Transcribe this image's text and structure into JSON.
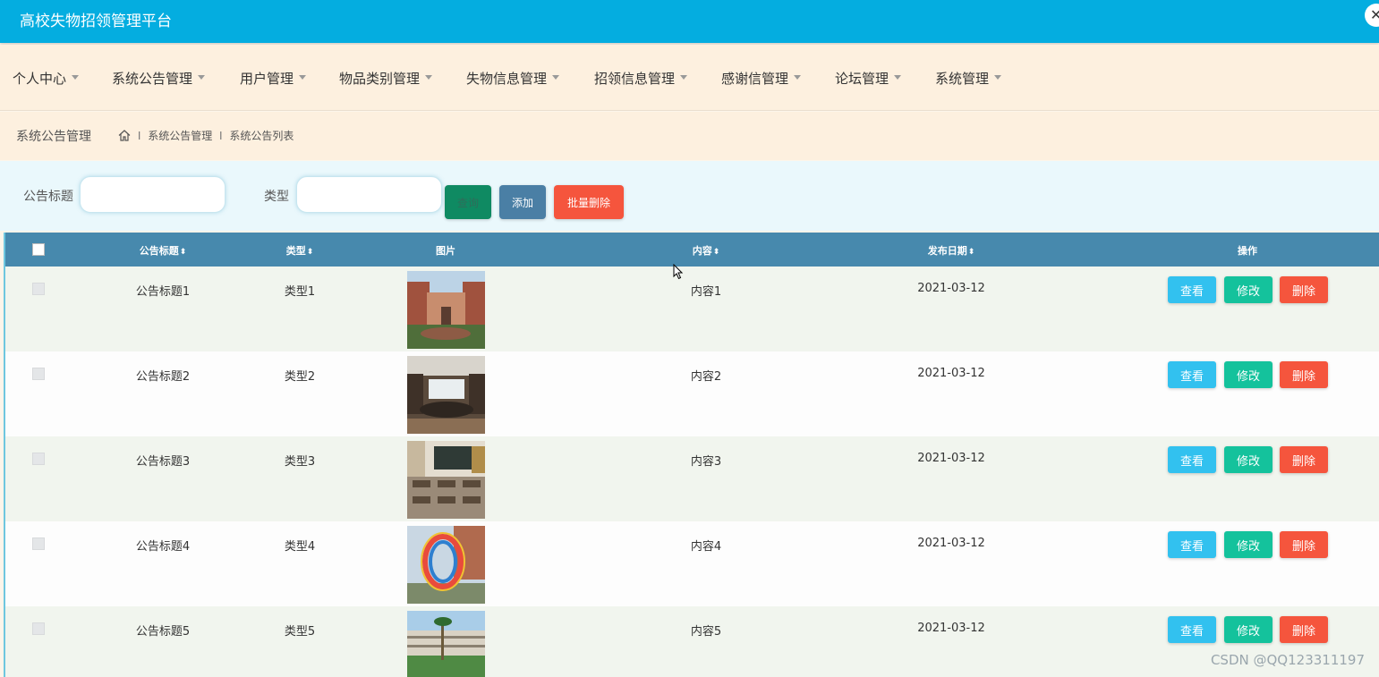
{
  "app": {
    "title": "高校失物招领管理平台",
    "close_glyph": "✕"
  },
  "nav": {
    "items": [
      {
        "label": "个人中心"
      },
      {
        "label": "系统公告管理"
      },
      {
        "label": "用户管理"
      },
      {
        "label": "物品类别管理"
      },
      {
        "label": "失物信息管理"
      },
      {
        "label": "招领信息管理"
      },
      {
        "label": "感谢信管理"
      },
      {
        "label": "论坛管理"
      },
      {
        "label": "系统管理"
      }
    ]
  },
  "breadcrumb": {
    "section_title": "系统公告管理",
    "separator": "I",
    "path": [
      "系统公告管理",
      "系统公告列表"
    ]
  },
  "search": {
    "title_label": "公告标题",
    "title_value": "",
    "type_label": "类型",
    "type_value": "",
    "query_label": "查询",
    "add_label": "添加",
    "batch_delete_label": "批量删除"
  },
  "table": {
    "headers": {
      "title": "公告标题",
      "type": "类型",
      "image": "图片",
      "content": "内容",
      "date": "发布日期",
      "actions": "操作"
    },
    "sort_glyph": "⬍",
    "action_labels": {
      "view": "查看",
      "edit": "修改",
      "delete": "删除"
    },
    "rows": [
      {
        "title": "公告标题1",
        "type": "类型1",
        "content": "内容1",
        "date": "2021-03-12"
      },
      {
        "title": "公告标题2",
        "type": "类型2",
        "content": "内容2",
        "date": "2021-03-12"
      },
      {
        "title": "公告标题3",
        "type": "类型3",
        "content": "内容3",
        "date": "2021-03-12"
      },
      {
        "title": "公告标题4",
        "type": "类型4",
        "content": "内容4",
        "date": "2021-03-12"
      },
      {
        "title": "公告标题5",
        "type": "类型5",
        "content": "内容5",
        "date": "2021-03-12"
      }
    ]
  },
  "watermark": "CSDN @QQ123311197",
  "colors": {
    "header": "#04ade0",
    "nav_bg": "#fdf0df",
    "table_head": "#4789ad",
    "btn_view": "#32c1ef",
    "btn_edit": "#14c29c",
    "btn_delete": "#f5553d"
  }
}
